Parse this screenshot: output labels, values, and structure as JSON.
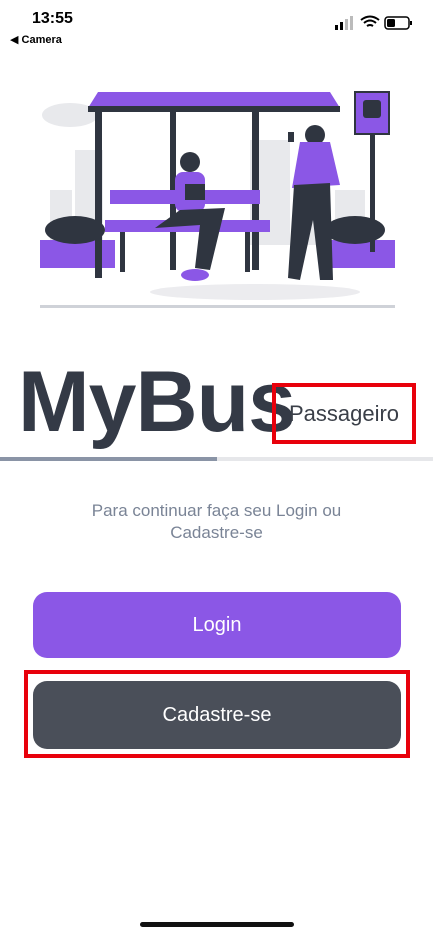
{
  "status_bar": {
    "time": "13:55",
    "back_app": "◀ Camera",
    "icons": [
      "signal-icon",
      "wifi-icon",
      "battery-icon"
    ]
  },
  "illustration": {
    "name": "bus-stop-illustration",
    "colors": {
      "accent": "#8b57e6",
      "dark": "#2f3540",
      "light_gray": "#e8e9ec"
    }
  },
  "brand": {
    "title": "MyBus",
    "subtitle": "Passageiro"
  },
  "progress": {
    "fraction": 0.5
  },
  "instruction": "Para continuar faça seu Login ou Cadastre-se",
  "buttons": {
    "login": "Login",
    "cadastro": "Cadastre-se"
  },
  "colors": {
    "login_bg": "#8b57e6",
    "cadastro_bg": "#4a4f59",
    "highlight": "#e8000b"
  }
}
